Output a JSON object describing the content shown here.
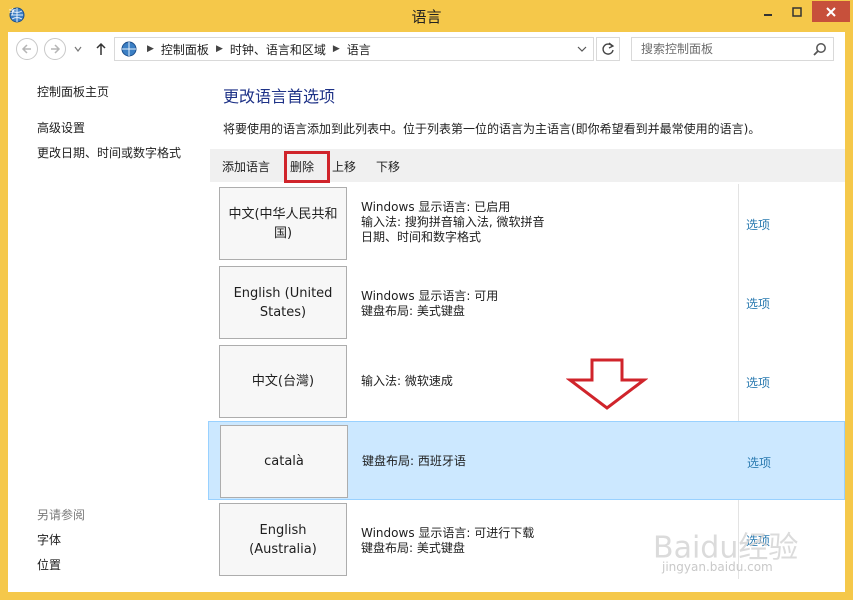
{
  "window": {
    "title": "语言",
    "controls": {
      "minimize": "minimize-icon",
      "maximize": "maximize-icon",
      "close": "close-icon"
    }
  },
  "address_bar": {
    "breadcrumbs": [
      "控制面板",
      "时钟、语言和区域",
      "语言"
    ],
    "search_placeholder": "搜索控制面板"
  },
  "sidebar": {
    "home": "控制面板主页",
    "links": [
      "高级设置",
      "更改日期、时间或数字格式"
    ],
    "see_also_heading": "另请参阅",
    "see_also": [
      "字体",
      "位置"
    ]
  },
  "main": {
    "heading": "更改语言首选项",
    "description": "将要使用的语言添加到此列表中。位于列表第一位的语言为主语言(即你希望看到并最常使用的语言)。",
    "toolbar": {
      "add": "添加语言",
      "remove": "删除",
      "up": "上移",
      "down": "下移"
    },
    "languages": [
      {
        "name": "中文(中华人民共和国)",
        "details": [
          "Windows 显示语言: 已启用",
          "输入法: 搜狗拼音输入法, 微软拼音",
          "日期、时间和数字格式"
        ],
        "options": "选项",
        "selected": false
      },
      {
        "name": "English (United States)",
        "details": [
          "Windows 显示语言: 可用",
          "键盘布局: 美式键盘"
        ],
        "options": "选项",
        "selected": false
      },
      {
        "name": "中文(台灣)",
        "details": [
          "输入法: 微软速成"
        ],
        "options": "选项",
        "selected": false
      },
      {
        "name": "català",
        "details": [
          "键盘布局: 西班牙语"
        ],
        "options": "选项",
        "selected": true
      },
      {
        "name": "English (Australia)",
        "details": [
          "Windows 显示语言: 可进行下载",
          "键盘布局: 美式键盘"
        ],
        "options": "选项",
        "selected": false
      }
    ]
  },
  "watermark": {
    "text": "Baidu经验",
    "url": "jingyan.baidu.com"
  },
  "colors": {
    "title_bar": "#f5c84a",
    "heading": "#1e3287",
    "link": "#2a7ab0",
    "selection": "#cce8ff",
    "highlight_box": "#d0242b"
  }
}
